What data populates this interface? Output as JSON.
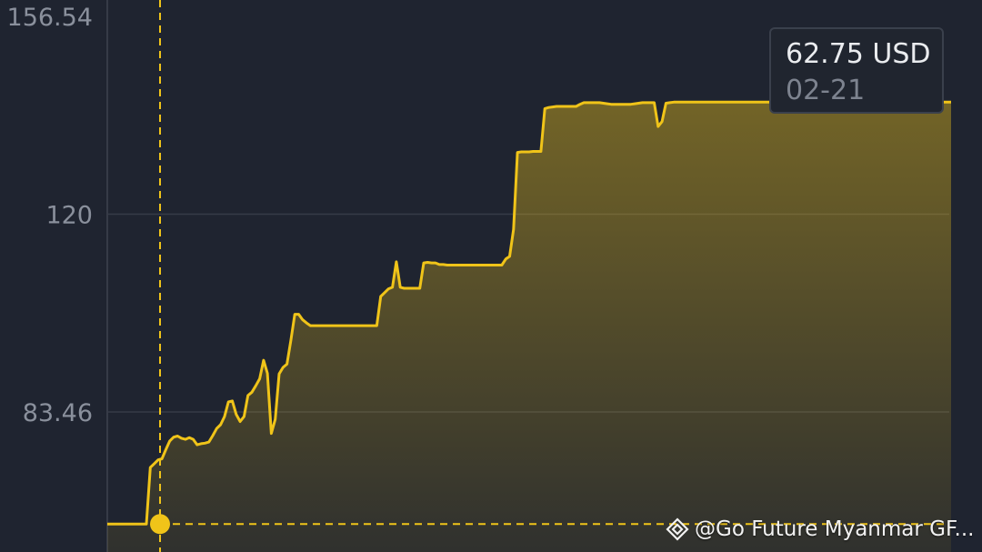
{
  "colors": {
    "background": "#1f2430",
    "line": "#f0c419",
    "grid": "#363b47",
    "crosshair": "#f0c419",
    "tick_text": "#8a909c"
  },
  "tooltip": {
    "value": "62.75 USD",
    "date": "02-21"
  },
  "watermark": {
    "text": "@Go Future Myanmar GF...",
    "logo_icon": "binance-square-logo"
  },
  "chart_data": {
    "type": "area",
    "title": "",
    "xlabel": "",
    "ylabel": "",
    "y_ticks": [
      "156.54",
      "120",
      "83.46"
    ],
    "y_tick_values": [
      156.54,
      120,
      83.46
    ],
    "ylim": [
      52,
      157
    ],
    "grid": true,
    "crosshair": {
      "y": 62.75,
      "x_index": 0
    },
    "x": [
      0,
      1,
      2,
      3,
      4,
      5,
      6,
      7,
      8,
      9,
      10,
      11,
      12,
      13,
      14,
      15,
      16,
      17,
      18,
      19,
      20,
      21,
      22,
      23,
      24,
      25,
      26,
      27,
      28,
      29,
      30,
      31,
      32,
      33,
      34,
      35,
      36,
      37,
      38,
      39,
      40,
      41,
      42,
      43,
      44,
      45,
      46,
      47,
      48,
      49,
      50,
      51,
      52,
      53,
      54,
      55,
      56,
      57,
      58,
      59,
      60,
      61,
      62,
      63,
      64,
      65,
      66,
      67,
      68,
      69,
      70,
      71,
      72,
      73,
      74,
      75,
      76,
      77,
      78,
      79,
      80,
      81,
      82,
      83,
      84,
      85,
      86,
      87,
      88,
      89,
      90,
      91,
      92,
      93,
      94,
      95,
      96,
      97,
      98,
      99,
      100,
      101,
      102,
      103,
      104,
      105,
      106,
      107,
      108,
      109,
      110,
      111,
      112,
      113,
      114,
      115,
      116,
      117,
      118,
      119,
      120,
      121,
      122,
      123,
      124,
      125,
      126,
      127,
      128,
      129,
      130,
      131,
      132,
      133,
      134,
      135,
      136,
      137,
      138,
      139,
      140,
      141,
      142,
      143,
      144,
      145,
      146,
      147,
      148,
      149,
      150,
      151,
      152,
      153,
      154,
      155,
      156,
      157,
      158,
      159,
      160,
      161,
      162,
      163,
      164,
      165,
      166,
      167,
      168,
      169,
      170,
      171,
      172,
      173,
      174,
      175,
      176,
      177,
      178,
      179,
      180,
      181,
      182,
      183,
      184,
      185,
      186,
      187,
      188,
      189,
      190,
      191,
      192,
      193,
      194,
      195,
      196,
      197,
      198,
      199,
      200,
      201,
      202,
      203,
      204,
      205,
      206,
      207,
      208
    ],
    "values": [
      62.75,
      62.75,
      62.75,
      62.75,
      62.75,
      62.75,
      62.75,
      62.75,
      62.75,
      62.75,
      62.75,
      73.2,
      73.9,
      74.6,
      74.8,
      76.5,
      78.1,
      78.8,
      79.0,
      78.6,
      78.4,
      78.7,
      78.4,
      77.4,
      77.6,
      77.7,
      77.9,
      79.1,
      80.4,
      81.1,
      82.6,
      85.3,
      85.5,
      83.0,
      81.7,
      82.6,
      86.5,
      87.1,
      88.3,
      89.6,
      93.0,
      90.6,
      79.5,
      82.1,
      90.5,
      91.7,
      92.3,
      96.7,
      101.5,
      101.5,
      100.5,
      99.9,
      99.4,
      99.4,
      99.4,
      99.4,
      99.4,
      99.4,
      99.4,
      99.4,
      99.4,
      99.4,
      99.4,
      99.4,
      99.4,
      99.4,
      99.4,
      99.4,
      99.4,
      99.4,
      104.8,
      105.5,
      106.2,
      106.5,
      111.2,
      106.5,
      106.3,
      106.3,
      106.3,
      106.3,
      106.3,
      111.0,
      111.1,
      111.0,
      111.0,
      110.7,
      110.7,
      110.6,
      110.6,
      110.6,
      110.6,
      110.6,
      110.6,
      110.6,
      110.6,
      110.6,
      110.6,
      110.6,
      110.6,
      110.6,
      110.6,
      110.6,
      111.7,
      112.2,
      117.2,
      131.4,
      131.5,
      131.5,
      131.5,
      131.6,
      131.6,
      131.6,
      139.5,
      139.7,
      139.8,
      139.9,
      139.9,
      139.9,
      139.9,
      139.9,
      139.9,
      140.3,
      140.6,
      140.6,
      140.6,
      140.6,
      140.6,
      140.5,
      140.4,
      140.3,
      140.3,
      140.3,
      140.3,
      140.3,
      140.3,
      140.4,
      140.5,
      140.6,
      140.6,
      140.6,
      140.6,
      136.2,
      137.1,
      140.5,
      140.6,
      140.7,
      140.7,
      140.7,
      140.7,
      140.7,
      140.7,
      140.7,
      140.7,
      140.7,
      140.7,
      140.7,
      140.7,
      140.7,
      140.7,
      140.7,
      140.7,
      140.7,
      140.7,
      140.7,
      140.7,
      140.7,
      140.7,
      140.7,
      140.7,
      140.7,
      140.7,
      140.7,
      140.7,
      140.7,
      140.7,
      140.7,
      140.7,
      140.7,
      140.7,
      140.7,
      140.7,
      140.7,
      140.7,
      140.7,
      140.7,
      140.7,
      140.7,
      140.7,
      140.7,
      140.7,
      140.7,
      140.7,
      140.7,
      140.7,
      140.7,
      140.7,
      140.7,
      140.7,
      140.7,
      140.7,
      140.7,
      140.7,
      140.7,
      140.7,
      140.7,
      140.7,
      140.7,
      140.7,
      140.7,
      140.7,
      140.7,
      140.7,
      140.7,
      140.7,
      140.7,
      140.7,
      140.7
    ]
  }
}
